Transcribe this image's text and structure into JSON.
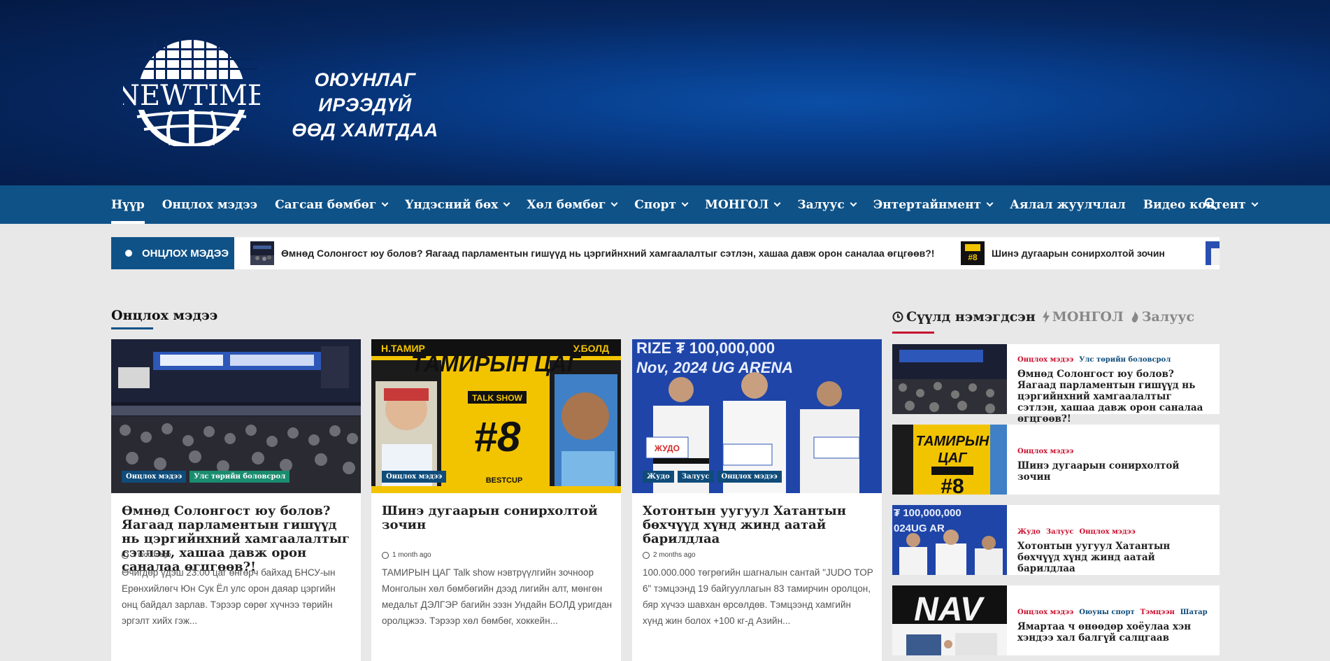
{
  "header": {
    "logo_text": "NEWTIME",
    "tagline_line1": "ОЮУНЛАГ ИРЭЭДҮЙ",
    "tagline_line2": "ӨӨД ХАМТДАА",
    "background_color": "#06265e"
  },
  "nav": {
    "items": [
      {
        "label": "Нүүр",
        "dropdown": false,
        "active": true
      },
      {
        "label": "Онцлох мэдээ",
        "dropdown": false
      },
      {
        "label": "Сагсан бөмбөг",
        "dropdown": true
      },
      {
        "label": "Үндэсний бөх",
        "dropdown": true
      },
      {
        "label": "Хөл бөмбөг",
        "dropdown": true
      },
      {
        "label": "Спорт",
        "dropdown": true
      },
      {
        "label": "МОНГОЛ",
        "dropdown": true
      },
      {
        "label": "Залуус",
        "dropdown": true
      },
      {
        "label": "Энтертайнмент",
        "dropdown": true
      },
      {
        "label": "Аялал жуулчлал",
        "dropdown": false
      },
      {
        "label": "Видео контент",
        "dropdown": true
      }
    ],
    "search_icon": "search-icon",
    "color": "#0f5287"
  },
  "ticker": {
    "label": "ОНЦЛОХ МЭДЭЭ",
    "items": [
      "Өмнөд Солонгост юу болов? Яагаад парламентын гишүүд нь цэргийнхний хамгаалалтыг сэтлэн, хашаа давж орон саналаа өгцгөөв?!",
      "Шинэ дугаарын сонирхолтой зочин"
    ]
  },
  "main": {
    "section_title": "Онцлох мэдээ",
    "cards": [
      {
        "tags": [
          "Онцлох мэдээ",
          "Улс төрийн боловсрол"
        ],
        "title": "Өмнөд Солонгост юу болов? Яагаад парламентын гишүүд нь цэргийнхний хамгаалалтыг сэтлэн, хашаа давж орон саналаа өгцгөөв?!",
        "meta": "1 month ago",
        "excerpt": "Өчигдөр үдэш 23:00 цаг өнгөрч байхад БНСУ-ын Ерөнхийлөгч Юн Сук Ёл улс орон даяар цэргийн онц байдал зарлав. Тэрээр сөрөг хүчнээ төрийн эргэлт хийх гэж..."
      },
      {
        "tags": [
          "Онцлох мэдээ"
        ],
        "title": "Шинэ дугаарын сонирхолтой зочин",
        "meta": "1 month ago",
        "excerpt": "ТАМИРЫН ЦАГ Talk show нэвтрүүлгийн зочноор Монголын хөл бөмбөгийн дээд лигийн алт, мөнгөн медальт ДЭЛГЭР багийн ээзн Ундайн БОЛД уригдан оролцжээ. Тэрээр хөл бөмбөг, хоккейн..."
      },
      {
        "tags": [
          "Жудо",
          "Залуус",
          "Онцлох мэдээ"
        ],
        "title": "Хотонтын уугуул Хатантын бөхчүүд хүнд жинд аатай барилдлаа",
        "meta": "2 months ago",
        "excerpt": "100.000.000 төгрөгийн шагналын сантай \"JUDO TOP 6\" тэмцээнд 19 байгууллагын 83 тамирчин оролцон, бяр хүчээ шавхан өрсөлдөв. Тэмцээнд хамгийн хүнд жин болох +100 кг-д Азийн..."
      }
    ],
    "card_images": {
      "card2_top_left": "Н.ТАМИР",
      "card2_top_right": "У.БОЛД",
      "card2_title": "ТАМИРЫН ЦАГ",
      "card2_sub": "TALK SHOW",
      "card2_num": "#8",
      "card2_brand": "BESTCUP",
      "card3_banner": "RIZE ₮ 100,000,000",
      "card3_banner2": "Nov, 2024 UG ARENA",
      "card3_sign": "ЖУДО"
    }
  },
  "sidebar": {
    "tabs": [
      {
        "label": "Сүүлд нэмэгдсэн",
        "icon": "clock-icon",
        "active": true
      },
      {
        "label": "МОНГОЛ",
        "icon": "bolt-icon",
        "active": false
      },
      {
        "label": "Залуус",
        "icon": "fire-icon",
        "active": false
      }
    ],
    "items": [
      {
        "cats": [
          {
            "t": "Онцлох мэдээ",
            "c": "red"
          },
          {
            "t": "Улс төрийн боловсрол",
            "c": "blue"
          }
        ],
        "title": "Өмнөд Солонгост юу болов? Яагаад парламентын гишүүд нь цэргийнхний хамгаалалтыг сэтлэн, хашаа давж орон саналаа өгцгөөв?!"
      },
      {
        "cats": [
          {
            "t": "Онцлох мэдээ",
            "c": "red"
          }
        ],
        "title": "Шинэ дугаарын сонирхолтой зочин"
      },
      {
        "cats": [
          {
            "t": "Жудо",
            "c": "red"
          },
          {
            "t": "Залуус",
            "c": "red"
          },
          {
            "t": "Онцлох мэдээ",
            "c": "red"
          }
        ],
        "title": "Хотонтын уугуул Хатантын бөхчүүд хүнд жинд аатай барилдлаа"
      },
      {
        "cats": [
          {
            "t": "Онцлох мэдээ",
            "c": "red"
          },
          {
            "t": "Оюуны спорт",
            "c": "blue"
          },
          {
            "t": "Тэмцээн",
            "c": "red"
          },
          {
            "t": "Шатар",
            "c": "blue"
          }
        ],
        "title": "Ямартаа ч өнөөдөр хоёулаа хэн хэндээ хал балгүй салцгаав"
      }
    ],
    "item4_image_text": "NAV"
  }
}
